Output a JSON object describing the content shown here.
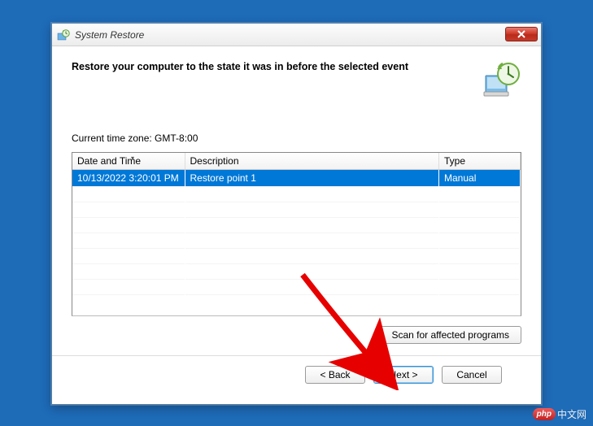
{
  "window": {
    "title": "System Restore"
  },
  "heading": "Restore your computer to the state it was in before the selected event",
  "timezone_label": "Current time zone: GMT-8:00",
  "table": {
    "columns": {
      "datetime": "Date and Time",
      "description": "Description",
      "type": "Type"
    },
    "rows": [
      {
        "datetime": "10/13/2022 3:20:01 PM",
        "description": "Restore point 1",
        "type": "Manual",
        "selected": true
      }
    ]
  },
  "buttons": {
    "scan": "Scan for affected programs",
    "back": "< Back",
    "next": "Next >",
    "cancel": "Cancel"
  },
  "watermark": {
    "badge": "php",
    "text": "中文网"
  }
}
